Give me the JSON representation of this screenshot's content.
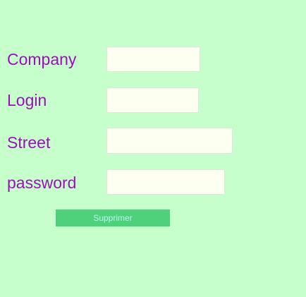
{
  "form": {
    "fields": [
      {
        "label": "Company",
        "value": "",
        "placeholder": ""
      },
      {
        "label": "Login",
        "value": "",
        "placeholder": ""
      },
      {
        "label": "Street",
        "value": "",
        "placeholder": ""
      },
      {
        "label": "password",
        "value": "",
        "placeholder": ""
      }
    ],
    "submit_label": "Supprimer"
  },
  "colors": {
    "background": "#c6ffcb",
    "label": "#9b10b8",
    "input_background": "#fdfff1",
    "button_background": "#4fd07a",
    "button_text": "#b7f5ef"
  }
}
